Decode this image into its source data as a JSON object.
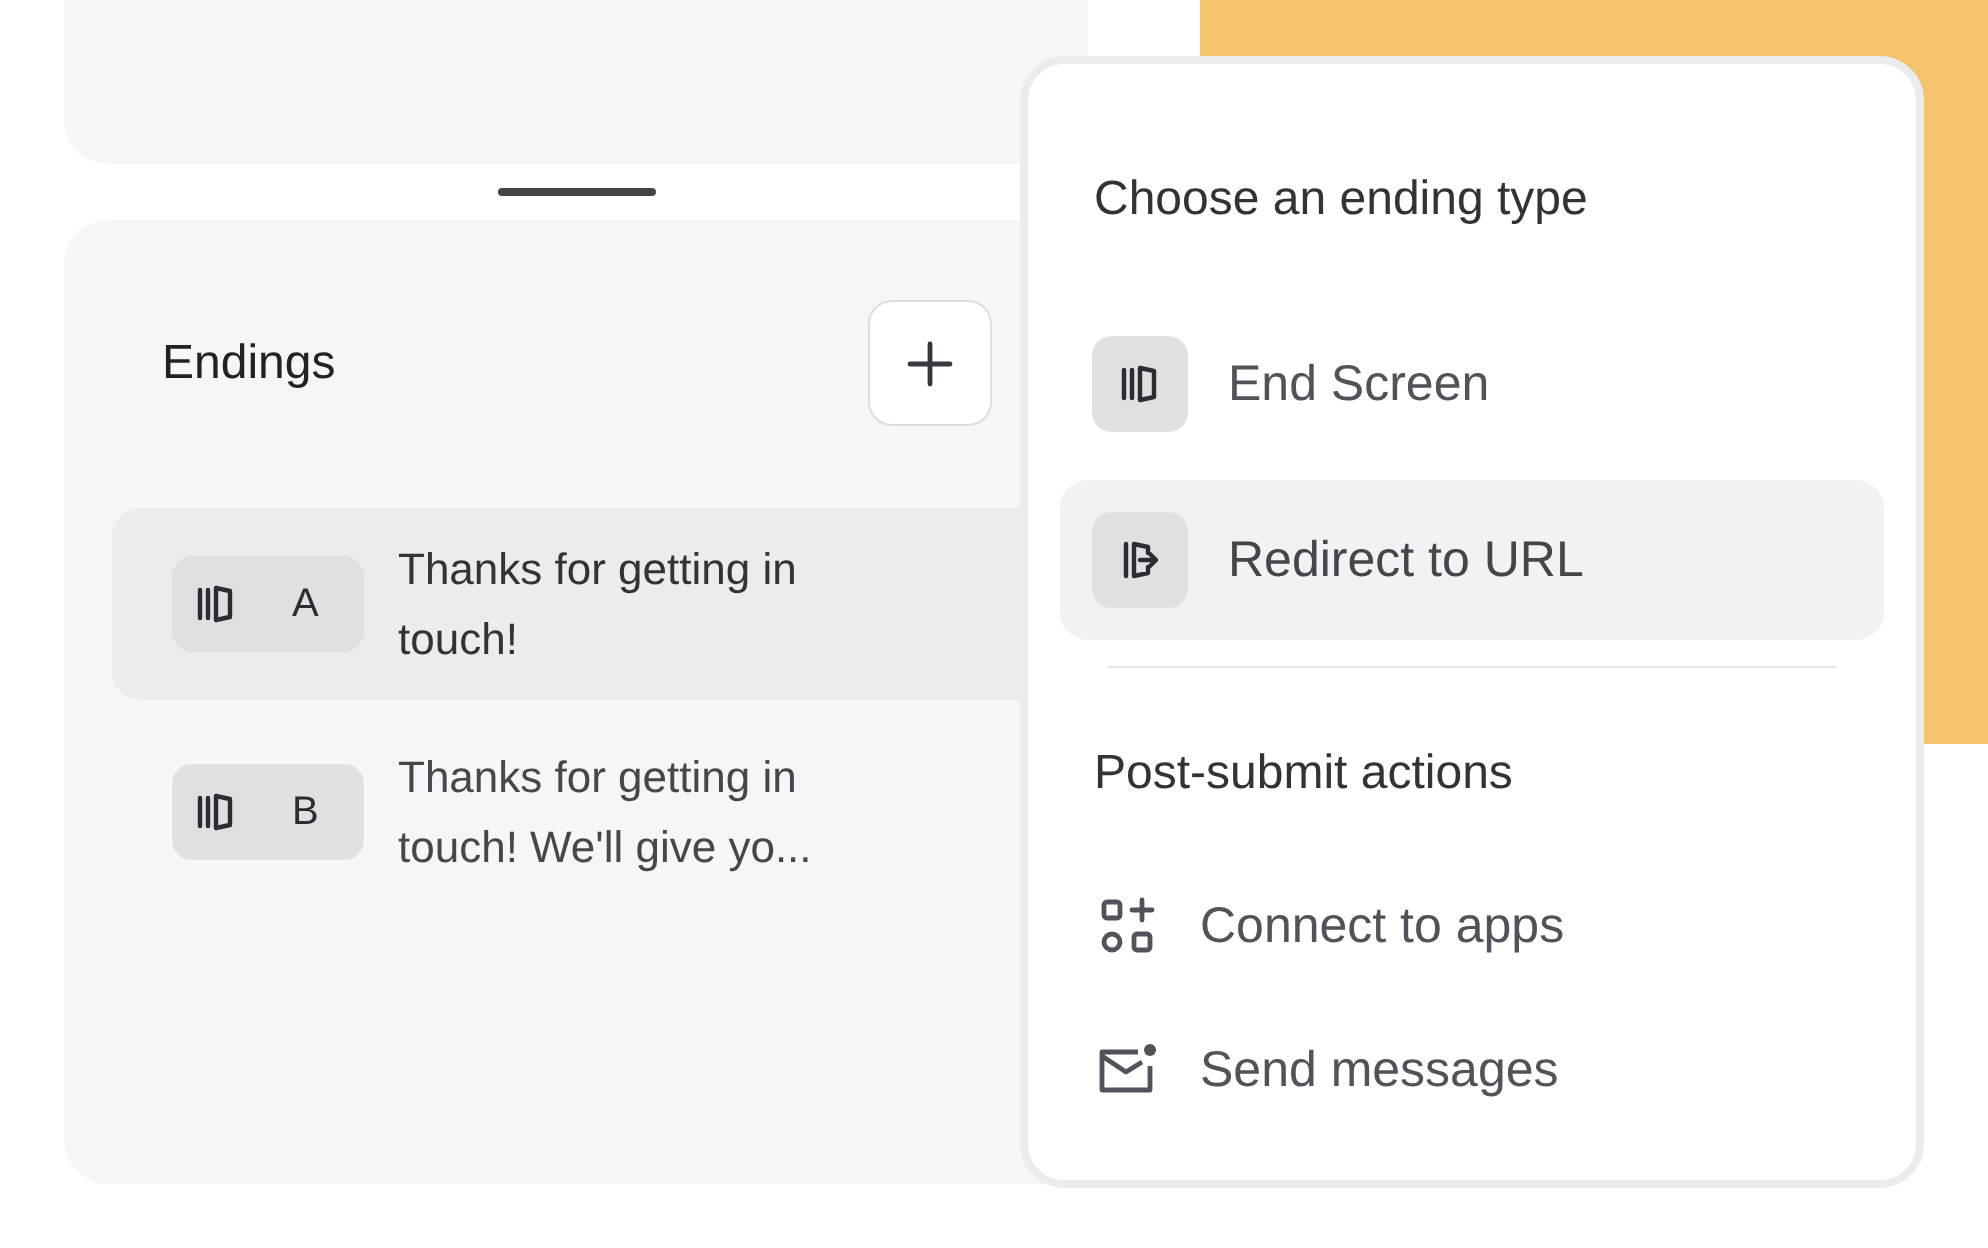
{
  "endings_panel": {
    "title": "Endings",
    "items": [
      {
        "letter": "A",
        "text": "Thanks for getting in touch!",
        "selected": true
      },
      {
        "letter": "B",
        "text": "Thanks for getting in touch! We'll give yo...",
        "selected": false
      }
    ]
  },
  "menu": {
    "sections": [
      {
        "title": "Choose an ending type",
        "items": [
          {
            "kind": "screen",
            "label": "End Screen",
            "selected": false
          },
          {
            "kind": "redirect",
            "label": "Redirect to URL",
            "selected": true
          }
        ]
      },
      {
        "title": "Post-submit actions",
        "items": [
          {
            "kind": "apps",
            "label": "Connect to apps",
            "selected": false
          },
          {
            "kind": "mail",
            "label": "Send messages",
            "selected": false
          }
        ]
      }
    ]
  }
}
